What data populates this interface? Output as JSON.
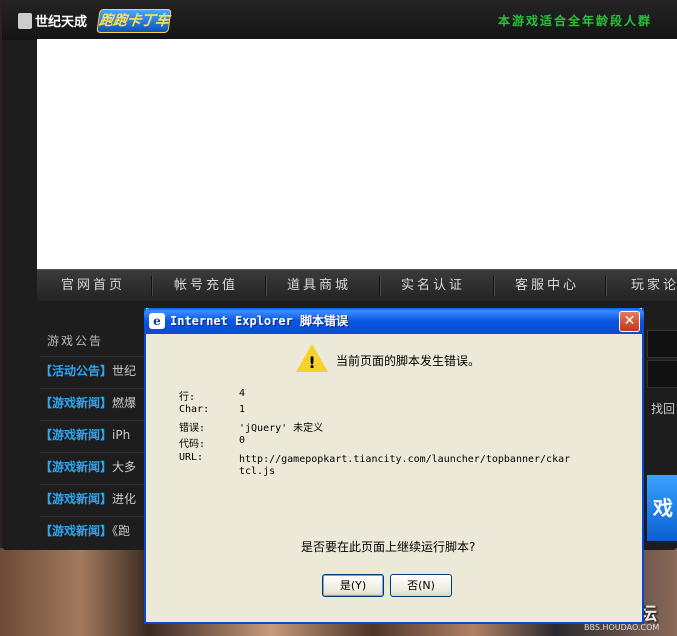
{
  "launcher": {
    "publisher_logo": "世纪天成",
    "game_logo": "跑跑卡丁车",
    "age_notice": "本游戏适合全年龄段人群",
    "nav": [
      "官网首页",
      "帐号充值",
      "道具商城",
      "实名认证",
      "客服中心",
      "玩家论"
    ],
    "news_title": "游戏公告",
    "news": [
      {
        "tag": "【活动公告】",
        "text": "世纪"
      },
      {
        "tag": "【游戏新闻】",
        "text": "燃爆"
      },
      {
        "tag": "【游戏新闻】",
        "text": "iPh"
      },
      {
        "tag": "【游戏新闻】",
        "text": "大多"
      },
      {
        "tag": "【游戏新闻】",
        "text": "进化"
      },
      {
        "tag": "【游戏新闻】",
        "text": "《跑"
      }
    ],
    "side_link": "找回",
    "side_button": "戏"
  },
  "dialog": {
    "title": "Internet Explorer 脚本错误",
    "close_label": "✕",
    "headline": "当前页面的脚本发生错误。",
    "details": [
      {
        "label": "行:",
        "value": "4"
      },
      {
        "label": "Char:",
        "value": "1"
      },
      {
        "label": "错误:",
        "value": "'jQuery' 未定义"
      },
      {
        "label": "代码:",
        "value": "0"
      },
      {
        "label": "URL:",
        "value": "http://gamepopkart.tiancity.com/launcher/topbanner/ckar"
      },
      {
        "label": "",
        "value": "tcl.js"
      }
    ],
    "question": "是否要在此页面上继续运行脚本?",
    "yes_label": "是(Y)",
    "no_label": "否(N)"
  },
  "watermark": {
    "text": "猴岛论坛",
    "sub": "BBS.HOUDAO.COM"
  }
}
